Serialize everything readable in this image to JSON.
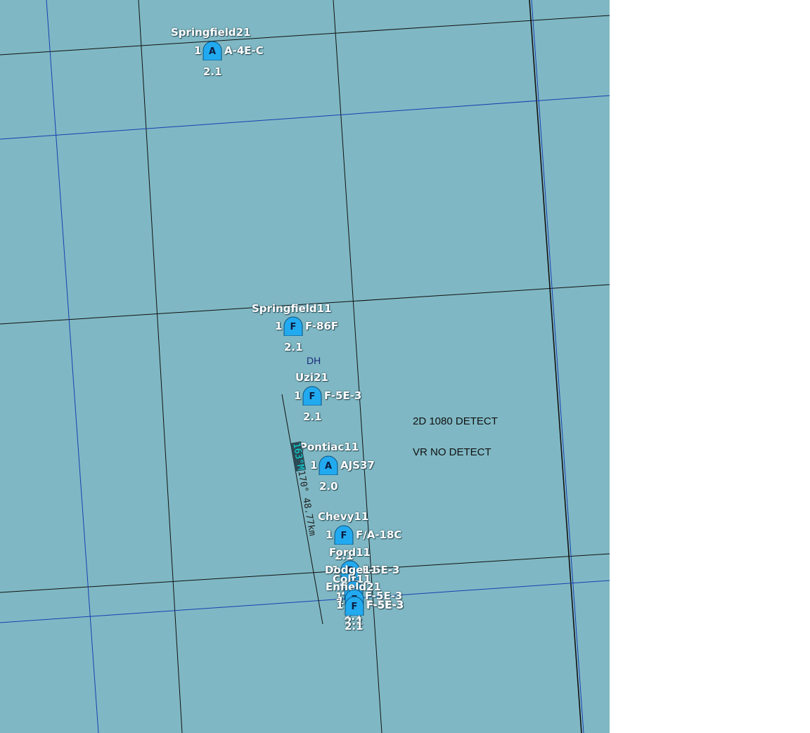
{
  "map": {
    "background": "#7fb8c4",
    "grid_major_color": "#111111",
    "grid_minor_color": "#1a3fb0"
  },
  "units": [
    {
      "id": "springfield21",
      "callsign": "Springfield21",
      "count": "1",
      "symbol": "A",
      "aircraft": "A-4E-C",
      "altitude": "2.1"
    },
    {
      "id": "springfield11",
      "callsign": "Springfield11",
      "count": "1",
      "symbol": "F",
      "aircraft": "F-86F",
      "altitude": "2.1"
    },
    {
      "id": "uzi21",
      "callsign": "Uzi21",
      "count": "1",
      "symbol": "F",
      "aircraft": "F-5E-3",
      "altitude": "2.1"
    },
    {
      "id": "pontiac11",
      "callsign": "Pontiac11",
      "count": "1",
      "symbol": "A",
      "aircraft": "AJS37",
      "altitude": "2.0"
    },
    {
      "id": "chevy11",
      "callsign": "Chevy11",
      "count": "1",
      "symbol": "F",
      "aircraft": "F/A-18C",
      "altitude": "2.1"
    },
    {
      "id": "ford11",
      "callsign": "Ford11",
      "count": "1",
      "symbol": "F",
      "aircraft": "F-5E-3",
      "altitude": "2.1"
    },
    {
      "id": "colt11",
      "callsign": "Colt11",
      "count": "1",
      "symbol": "F",
      "aircraft": "F-5E-3",
      "altitude": "2.1"
    },
    {
      "id": "enfield21",
      "callsign": "Enfield21",
      "count": "1",
      "symbol": "F",
      "aircraft": "F-5E-3",
      "altitude": "2.1"
    },
    {
      "id": "dodge11",
      "callsign": "Dodge11",
      "count": "1",
      "symbol": "F",
      "aircraft": "F-5E-3",
      "altitude": "2.1"
    }
  ],
  "marker": {
    "label": "DH"
  },
  "ruler": {
    "heading": "163°M",
    "bearing": "170°",
    "distance": "48.77km"
  },
  "notes": {
    "line1": "2D 1080 DETECT",
    "line2": "VR NO DETECT"
  }
}
